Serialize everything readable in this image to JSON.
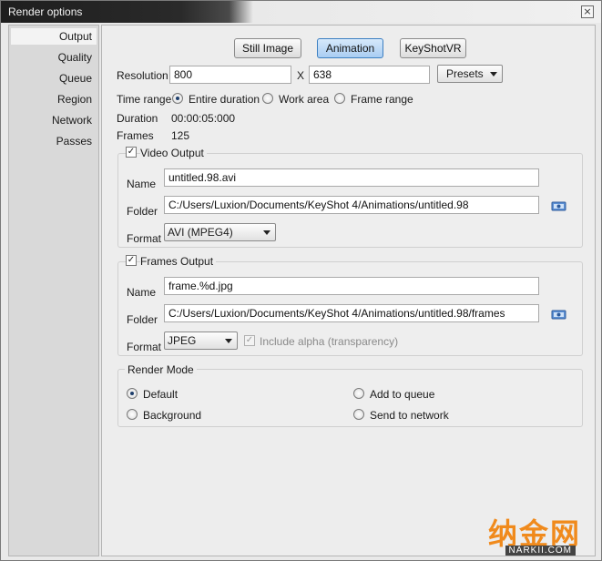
{
  "window": {
    "title": "Render options",
    "close_glyph": "×"
  },
  "sidebar": {
    "items": [
      {
        "label": "Output",
        "active": true
      },
      {
        "label": "Quality"
      },
      {
        "label": "Queue"
      },
      {
        "label": "Region"
      },
      {
        "label": "Network"
      },
      {
        "label": "Passes"
      }
    ]
  },
  "mode_tabs": {
    "still": "Still Image",
    "animation": "Animation",
    "keyshotvr": "KeyShotVR"
  },
  "resolution": {
    "label": "Resolution",
    "width": "800",
    "x_label": "X",
    "height": "638",
    "presets": "Presets"
  },
  "time_range": {
    "label": "Time range",
    "options": [
      "Entire duration",
      "Work area",
      "Frame range"
    ],
    "selected": "Entire duration"
  },
  "duration": {
    "label": "Duration",
    "value": "00:00:05:000"
  },
  "frames": {
    "label": "Frames",
    "value": "125"
  },
  "video_output": {
    "checkbox_label": "Video Output",
    "checked": true,
    "name_label": "Name",
    "name": "untitled.98.avi",
    "folder_label": "Folder",
    "folder": "C:/Users/Luxion/Documents/KeyShot 4/Animations/untitled.98",
    "format_label": "Format",
    "format": "AVI (MPEG4)"
  },
  "frames_output": {
    "checkbox_label": "Frames Output",
    "checked": true,
    "name_label": "Name",
    "name": "frame.%d.jpg",
    "folder_label": "Folder",
    "folder": "C:/Users/Luxion/Documents/KeyShot 4/Animations/untitled.98/frames",
    "format_label": "Format",
    "format": "JPEG",
    "alpha_label": "Include alpha (transparency)"
  },
  "render_mode": {
    "title": "Render Mode",
    "default": "Default",
    "background": "Background",
    "add_to_queue": "Add to queue",
    "send_to_network": "Send to network",
    "selected": "Default"
  },
  "watermark": {
    "cn": "纳金网",
    "en": "NARKII.COM"
  },
  "icons": {
    "folder": "folder-browse-icon",
    "dropdown": "chevron-down-icon",
    "close": "close-icon"
  },
  "colors": {
    "accent": "#a9cdf2",
    "watermark": "#f08a1c"
  }
}
